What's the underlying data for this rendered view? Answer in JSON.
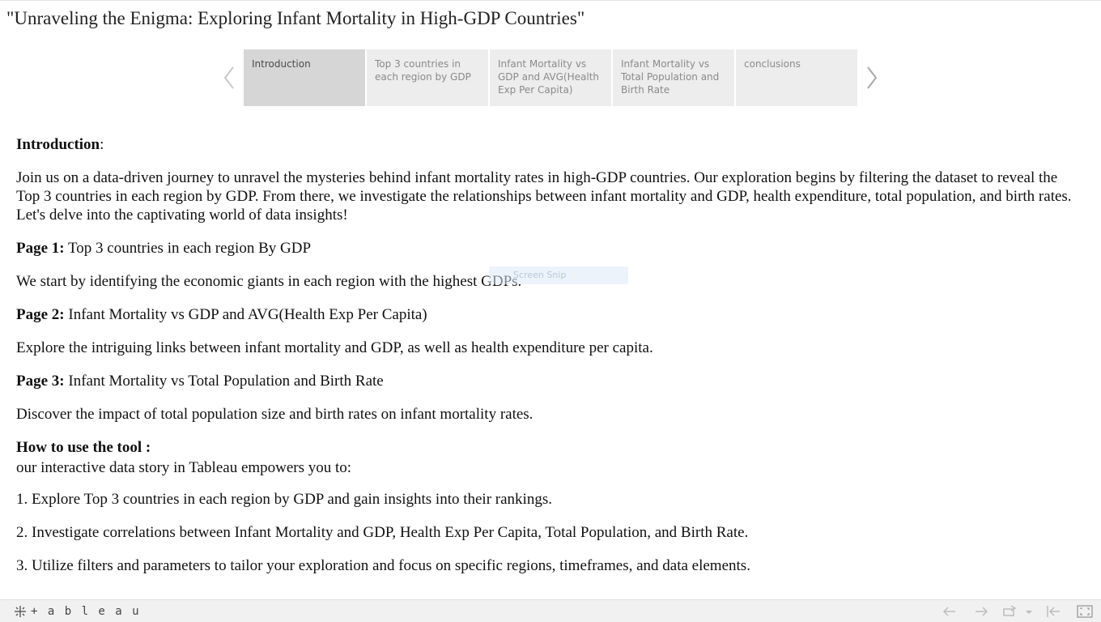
{
  "page": {
    "title": "\"Unraveling the Enigma: Exploring Infant Mortality in High-GDP Countries\""
  },
  "story": {
    "points": [
      {
        "label": "Introduction",
        "active": true
      },
      {
        "label": "Top 3 countries in each region by GDP",
        "active": false
      },
      {
        "label": "Infant Mortality vs GDP and AVG(Health Exp Per Capita)",
        "active": false
      },
      {
        "label": " Infant Mortality vs Total Population and Birth Rate",
        "active": false
      },
      {
        "label": "conclusions",
        "active": false
      }
    ]
  },
  "content": {
    "intro_heading": "Introduction",
    "intro_colon": ":",
    "intro_body": "Join us on a data-driven journey to unravel the mysteries behind infant mortality rates in high-GDP countries. Our exploration begins by filtering the dataset to reveal the Top 3 countries in each region by GDP. From there, we investigate the relationships between infant mortality and GDP, health expenditure, total population, and birth rates. Let's delve into the captivating world of data insights!",
    "page1_label": "Page 1:",
    "page1_title": " Top 3 countries in each region By GDP",
    "page1_desc": "We start by identifying the economic giants in each region with the highest GDPs.",
    "page2_label": "Page 2:",
    "page2_title": " Infant Mortality vs GDP and AVG(Health Exp Per Capita)",
    "page2_desc": "Explore the intriguing links between infant mortality and GDP, as well as health expenditure per capita.",
    "page3_label": "Page 3:",
    "page3_title": " Infant Mortality vs Total Population and Birth Rate",
    "page3_desc": "Discover the impact of total population size and birth rates on infant mortality rates.",
    "howto_heading": "How to use the tool :",
    "howto_intro": "our interactive data story in Tableau empowers you to:",
    "step1": "1. Explore Top 3 countries in each region by GDP and gain insights into their rankings.",
    "step2": "2. Investigate correlations between Infant Mortality and GDP, Health Exp Per Capita, Total Population, and Birth Rate.",
    "step3": "3. Utilize filters and parameters to tailor your exploration and focus on specific regions, timeframes, and data elements."
  },
  "overlay": {
    "watermark_text": "Screen Snip"
  },
  "toolbar": {
    "logo_text": "+ a b l e a u",
    "icons": [
      "tableau-logo-icon",
      "undo-icon",
      "redo-icon",
      "revert-icon",
      "dropdown-icon",
      "revert-all-icon",
      "fullscreen-icon"
    ]
  },
  "colors": {
    "active_tab": "#d6d6d6",
    "inactive_tab": "#ededed",
    "toolbar_bg": "#f1f1f1"
  }
}
